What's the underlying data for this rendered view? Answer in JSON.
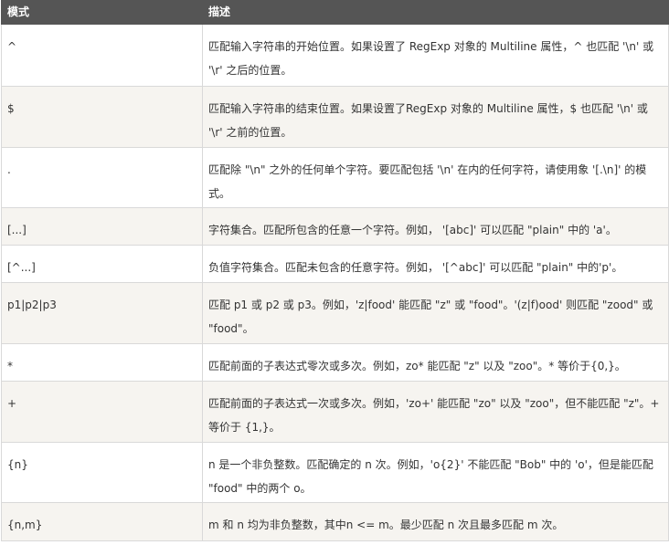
{
  "table": {
    "headers": {
      "pattern": "模式",
      "desc": "描述"
    },
    "rows": [
      {
        "pattern": "^",
        "desc": "匹配输入字符串的开始位置。如果设置了 RegExp 对象的 Multiline 属性，^ 也匹配 '\\n' 或 '\\r' 之后的位置。"
      },
      {
        "pattern": "$",
        "desc": "匹配输入字符串的结束位置。如果设置了RegExp 对象的 Multiline 属性，$ 也匹配 '\\n' 或 '\\r' 之前的位置。"
      },
      {
        "pattern": ".",
        "desc": "匹配除 \"\\n\" 之外的任何单个字符。要匹配包括 '\\n' 在内的任何字符，请使用象 '[.\\n]' 的模式。"
      },
      {
        "pattern": "[...]",
        "desc": "字符集合。匹配所包含的任意一个字符。例如， '[abc]' 可以匹配 \"plain\" 中的 'a'。"
      },
      {
        "pattern": "[^...]",
        "desc": "负值字符集合。匹配未包含的任意字符。例如， '[^abc]' 可以匹配 \"plain\" 中的'p'。"
      },
      {
        "pattern": "p1|p2|p3",
        "desc": "匹配 p1 或 p2 或 p3。例如，'z|food' 能匹配 \"z\" 或 \"food\"。'(z|f)ood' 则匹配 \"zood\" 或 \"food\"。"
      },
      {
        "pattern": "*",
        "desc": "匹配前面的子表达式零次或多次。例如，zo* 能匹配 \"z\" 以及 \"zoo\"。* 等价于{0,}。"
      },
      {
        "pattern": "+",
        "desc": "匹配前面的子表达式一次或多次。例如，'zo+' 能匹配 \"zo\" 以及 \"zoo\"，但不能匹配 \"z\"。+ 等价于 {1,}。"
      },
      {
        "pattern": "{n}",
        "desc": "n 是一个非负整数。匹配确定的 n 次。例如，'o{2}' 不能匹配 \"Bob\" 中的 'o'，但是能匹配 \"food\" 中的两个 o。"
      },
      {
        "pattern": "{n,m}",
        "desc": "m 和 n 均为非负整数，其中n <= m。最少匹配 n 次且最多匹配 m 次。"
      }
    ]
  }
}
